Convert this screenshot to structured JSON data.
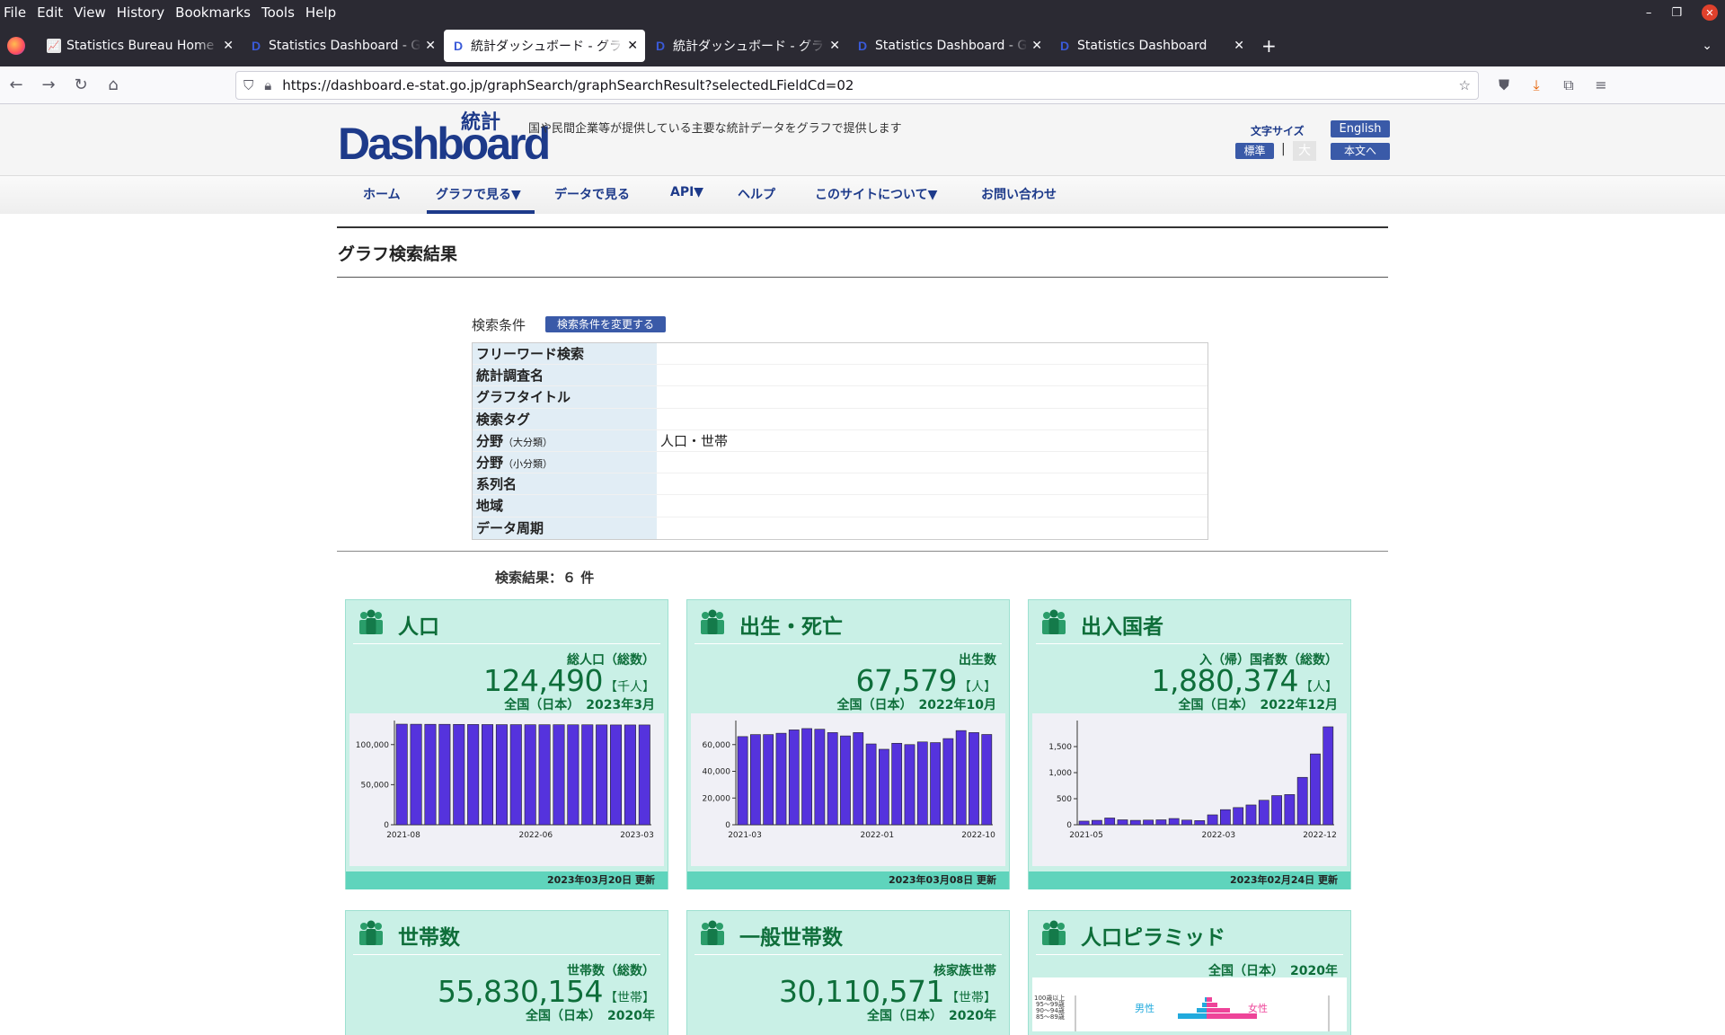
{
  "browser": {
    "menu": [
      "File",
      "Edit",
      "View",
      "History",
      "Bookmarks",
      "Tools",
      "Help"
    ],
    "tabs": [
      {
        "title": "Statistics Bureau Home P",
        "favicon": "chart-favicon",
        "active": false
      },
      {
        "title": "Statistics Dashboard - Gra",
        "favicon": "dashboard-favicon",
        "active": false
      },
      {
        "title": "統計ダッシュボード - グラ",
        "favicon": "dashboard-favicon",
        "active": true
      },
      {
        "title": "統計ダッシュボード - グラ",
        "favicon": "dashboard-favicon",
        "active": false
      },
      {
        "title": "Statistics Dashboard - Gra",
        "favicon": "dashboard-favicon",
        "active": false
      },
      {
        "title": "Statistics Dashboard",
        "favicon": "dashboard-favicon",
        "active": false
      }
    ],
    "url": "https://dashboard.e-stat.go.jp/graphSearch/graphSearchResult?selectedLFieldCd=02",
    "window_controls": [
      "–",
      "❐",
      "✕"
    ]
  },
  "site": {
    "logo_text": "Dashboard",
    "logo_kanji": "統計",
    "tagline": "国や民間企業等が提供している主要な統計データをグラフで提供します",
    "font_size_label": "文字サイズ",
    "font_std": "標準",
    "font_sep": "|",
    "font_large": "大",
    "english": "English",
    "to_main": "本文へ",
    "nav": [
      "ホーム",
      "グラフで見る▼",
      "データで見る",
      "API▼",
      "ヘルプ",
      "このサイトについて▼",
      "お問い合わせ"
    ]
  },
  "page": {
    "title": "グラフ検索結果",
    "conditions_label": "検索条件",
    "change_conditions": "検索条件を変更する",
    "conditions": [
      {
        "key": "フリーワード検索",
        "small": "",
        "value": ""
      },
      {
        "key": "統計調査名",
        "small": "",
        "value": ""
      },
      {
        "key": "グラフタイトル",
        "small": "",
        "value": ""
      },
      {
        "key": "検索タグ",
        "small": "",
        "value": ""
      },
      {
        "key": "分野",
        "small": "（大分類）",
        "value": "人口・世帯"
      },
      {
        "key": "分野",
        "small": "（小分類）",
        "value": ""
      },
      {
        "key": "系列名",
        "small": "",
        "value": ""
      },
      {
        "key": "地域",
        "small": "",
        "value": ""
      },
      {
        "key": "データ周期",
        "small": "",
        "value": ""
      }
    ],
    "result_count": "検索結果：６ 件"
  },
  "cards": [
    {
      "title": "人口",
      "subtitle": "総人口（総数）",
      "value": "124,490",
      "unit": "【千人】",
      "area": "全国（日本）　2023年3月",
      "updated": "2023年03月20日 更新"
    },
    {
      "title": "出生・死亡",
      "subtitle": "出生数",
      "value": "67,579",
      "unit": "【人】",
      "area": "全国（日本）　2022年10月",
      "updated": "2023年03月08日 更新"
    },
    {
      "title": "出入国者",
      "subtitle": "入（帰）国者数（総数）",
      "value": "1,880,374",
      "unit": "【人】",
      "area": "全国（日本）　2022年12月",
      "updated": "2023年02月24日 更新"
    },
    {
      "title": "世帯数",
      "subtitle": "世帯数（総数）",
      "value": "55,830,154",
      "unit": "【世帯】",
      "area": "全国（日本）　2020年"
    },
    {
      "title": "一般世帯数",
      "subtitle": "核家族世帯",
      "value": "30,110,571",
      "unit": "【世帯】",
      "area": "全国（日本）　2020年"
    },
    {
      "title": "人口ピラミッド",
      "area": "全国（日本）　2020年",
      "male": "男性",
      "female": "女性",
      "age_labels": [
        "100歳以上",
        "95～99歳",
        "90～94歳",
        "85～89歳"
      ]
    }
  ],
  "chart_data": [
    {
      "type": "bar",
      "x_ticks": [
        "2021-08",
        "2022-06",
        "2023-03"
      ],
      "y_ticks": [
        "0",
        "50,000",
        "100,000"
      ],
      "ylim": [
        0,
        130000
      ],
      "values": [
        125500,
        125400,
        125300,
        125300,
        125200,
        125100,
        125000,
        124900,
        124900,
        124800,
        124800,
        124800,
        124700,
        124700,
        124600,
        124500,
        124500,
        124490
      ],
      "color": "#5533dd"
    },
    {
      "type": "bar",
      "x_ticks": [
        "2021-03",
        "2022-01",
        "2022-10"
      ],
      "y_ticks": [
        "0",
        "20,000",
        "40,000",
        "60,000"
      ],
      "ylim": [
        0,
        78000
      ],
      "values": [
        66000,
        67500,
        67500,
        68500,
        71000,
        72000,
        71500,
        69000,
        66500,
        69000,
        60500,
        56500,
        61000,
        60000,
        62000,
        61500,
        64500,
        70500,
        69000,
        67579
      ],
      "color": "#5533dd"
    },
    {
      "type": "bar",
      "x_ticks": [
        "2021-05",
        "2022-03",
        "2022-12"
      ],
      "y_ticks": [
        "0",
        "500",
        "1,000",
        "1,500"
      ],
      "ylim": [
        0,
        2000
      ],
      "values": [
        70,
        85,
        130,
        95,
        85,
        90,
        95,
        120,
        90,
        80,
        190,
        290,
        330,
        380,
        470,
        560,
        580,
        910,
        1360,
        1880
      ],
      "color": "#5533dd"
    }
  ]
}
